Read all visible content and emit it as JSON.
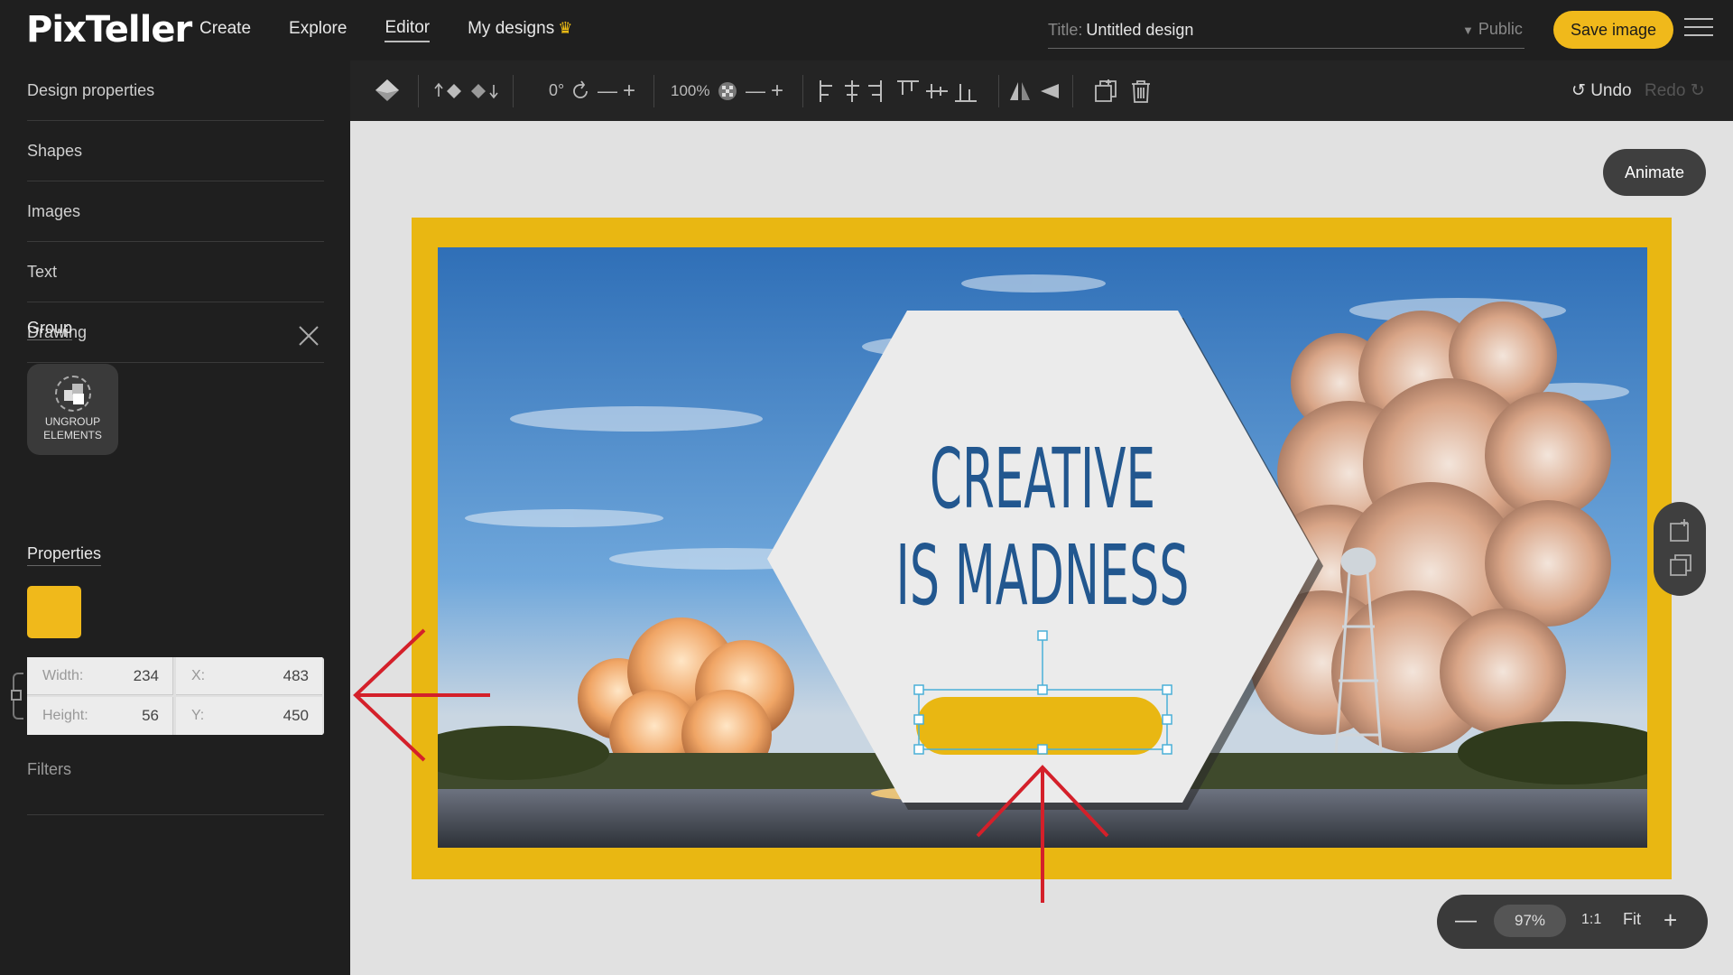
{
  "app": {
    "logo": "PixTeller",
    "nav": {
      "create": "Create",
      "explore": "Explore",
      "editor": "Editor",
      "my_designs": "My designs"
    },
    "title_label": "Title:",
    "title_value": "Untitled design",
    "visibility": "Public",
    "save_label": "Save image",
    "accent_color": "#f0b91b"
  },
  "sidebar": {
    "items": [
      "Design properties",
      "Shapes",
      "Images",
      "Text",
      "Drawing"
    ],
    "group_label": "Group",
    "ungroup_label_1": "UNGROUP",
    "ungroup_label_2": "ELEMENTS",
    "properties_label": "Properties",
    "fill_color": "#f0b91b",
    "width_label": "Width:",
    "width_value": "234",
    "height_label": "Height:",
    "height_value": "56",
    "x_label": "X:",
    "x_value": "483",
    "y_label": "Y:",
    "y_value": "450",
    "filters_label": "Filters"
  },
  "toolbar": {
    "rotation": "0°",
    "opacity": "100%",
    "undo_label": "Undo",
    "redo_label": "Redo"
  },
  "canvas": {
    "animate_label": "Animate",
    "headline_line1": "CREATIVE",
    "headline_line2": "IS MADNESS",
    "frame_color": "#e9b712",
    "text_color": "#22578f"
  },
  "zoom": {
    "minus": "—",
    "value": "97%",
    "ratio": "1:1",
    "fit": "Fit",
    "plus": "+"
  }
}
